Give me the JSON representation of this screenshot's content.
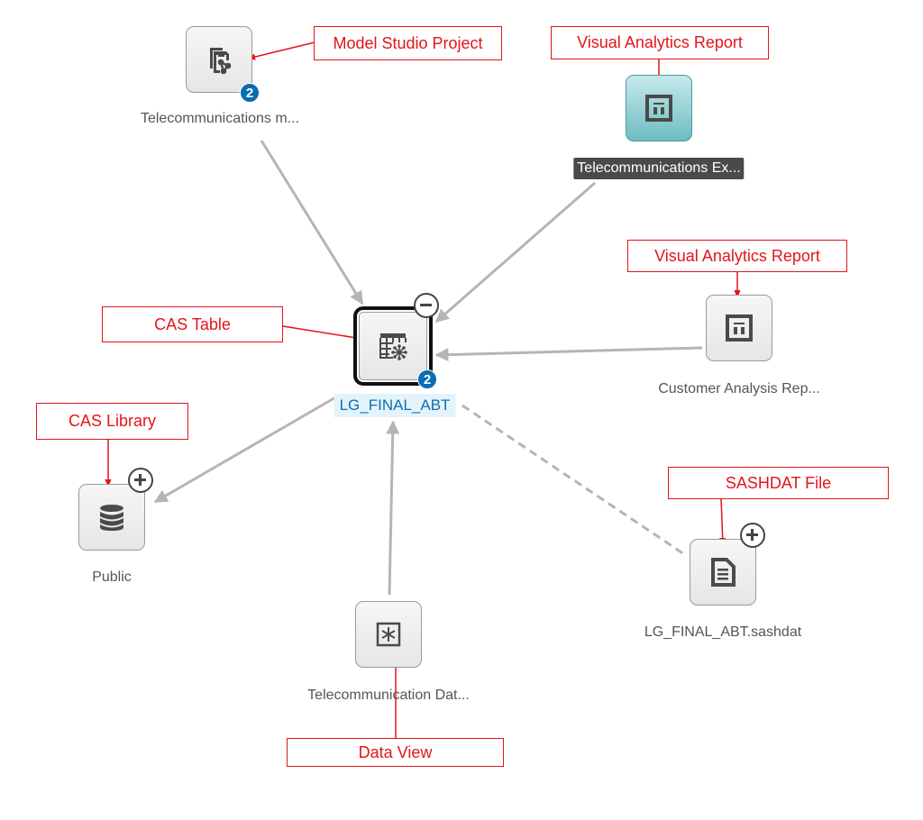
{
  "diagram": {
    "colors": {
      "edge": "#b5b5b5",
      "callout": "#e3141b",
      "badge": "#0a6db3",
      "selected_label_bg": "#e3f3fb",
      "selected_label_text": "#0f6fae",
      "teal_node": "#6fbcc2"
    },
    "nodes": [
      {
        "id": "model-project",
        "label": "Telecommunications m...",
        "type": "Model Studio Project",
        "icon": "model-project-icon",
        "badge": "2"
      },
      {
        "id": "va-report-1",
        "label": "Telecommunications Ex...",
        "type": "Visual Analytics Report",
        "icon": "report-icon",
        "state": "highlighted"
      },
      {
        "id": "cas-table",
        "label": "LG_FINAL_ABT",
        "type": "CAS Table",
        "icon": "cas-table-icon",
        "badge": "2",
        "toggle": "collapse",
        "state": "selected"
      },
      {
        "id": "va-report-2",
        "label": "Customer Analysis Rep...",
        "type": "Visual Analytics Report",
        "icon": "report-icon"
      },
      {
        "id": "cas-library",
        "label": "Public",
        "type": "CAS Library",
        "icon": "database-icon",
        "toggle": "expand"
      },
      {
        "id": "sashdat-file",
        "label": "LG_FINAL_ABT.sashdat",
        "type": "SASHDAT File",
        "icon": "file-icon",
        "toggle": "expand"
      },
      {
        "id": "data-view",
        "label": "Telecommunication Dat...",
        "type": "Data View",
        "icon": "data-view-icon"
      }
    ],
    "edges": [
      {
        "from": "model-project",
        "to": "cas-table",
        "style": "solid"
      },
      {
        "from": "va-report-1",
        "to": "cas-table",
        "style": "solid"
      },
      {
        "from": "va-report-2",
        "to": "cas-table",
        "style": "solid"
      },
      {
        "from": "cas-table",
        "to": "cas-library",
        "style": "solid"
      },
      {
        "from": "data-view",
        "to": "cas-table",
        "style": "solid"
      },
      {
        "from": "cas-table",
        "to": "sashdat-file",
        "style": "dashed"
      }
    ],
    "callouts": [
      {
        "id": "model-project",
        "text": "Model Studio Project"
      },
      {
        "id": "va-report-1",
        "text": "Visual Analytics Report"
      },
      {
        "id": "cas-table",
        "text": "CAS Table"
      },
      {
        "id": "va-report-2",
        "text": "Visual Analytics Report"
      },
      {
        "id": "cas-library",
        "text": "CAS Library"
      },
      {
        "id": "sashdat-file",
        "text": "SASHDAT File"
      },
      {
        "id": "data-view",
        "text": "Data View"
      }
    ]
  }
}
